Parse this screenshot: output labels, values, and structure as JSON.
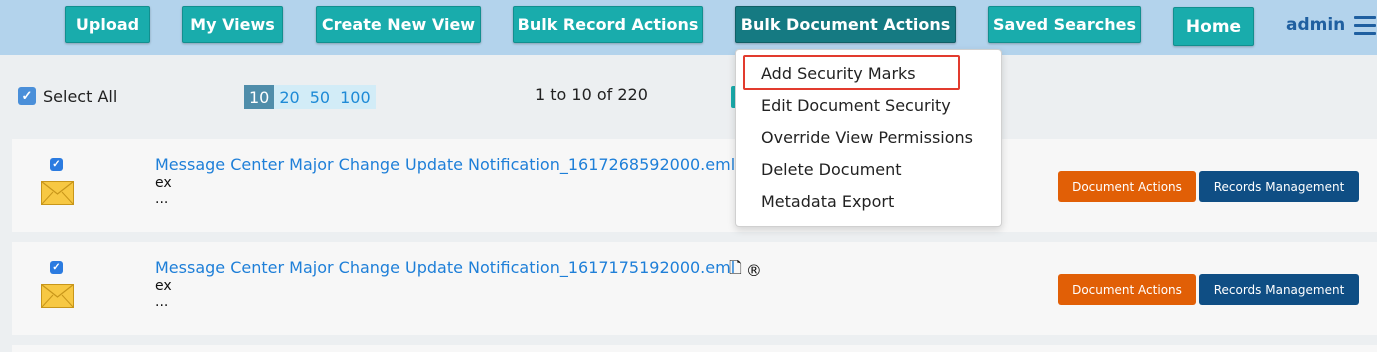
{
  "nav": {
    "upload": "Upload",
    "my_views": "My Views",
    "create_new_view": "Create New View",
    "bulk_record_actions": "Bulk Record Actions",
    "bulk_document_actions": "Bulk Document Actions",
    "saved_searches": "Saved Searches",
    "home": "Home",
    "user": "admin"
  },
  "toolbar": {
    "select_all_label": "Select All",
    "page_sizes": [
      "10",
      "20",
      "50",
      "100"
    ],
    "selected_page_size": "10",
    "range_text": "1 to 10 of 220"
  },
  "records": [
    {
      "title": "Message Center Major Change Update Notification_1617268592000.eml",
      "line1": "ex",
      "line2": "...",
      "checked": true,
      "document_actions": "Document Actions",
      "records_management": "Records Management"
    },
    {
      "title": "Message Center Major Change Update Notification_1617175192000.eml",
      "line1": "ex",
      "line2": "...",
      "checked": true,
      "glyph_doc": "🗋",
      "glyph_registered": "®",
      "document_actions": "Document Actions",
      "records_management": "Records Management"
    }
  ],
  "dropdown": {
    "items": [
      "Add Security Marks",
      "Edit Document Security",
      "Override View Permissions",
      "Delete Document",
      "Metadata Export"
    ],
    "highlighted": "Add Security Marks"
  },
  "colors": {
    "nav_button": "#19acac",
    "nav_active": "#157a82",
    "topbar": "#b3d3ec",
    "link": "#1e7fd8",
    "document_actions": "#e15f06",
    "records_management": "#0f4e84",
    "highlight_border": "#e23b2e"
  },
  "icons": {
    "menu": "hamburger-icon",
    "envelope": "envelope-icon",
    "checkbox": "checkbox-checked-icon"
  }
}
